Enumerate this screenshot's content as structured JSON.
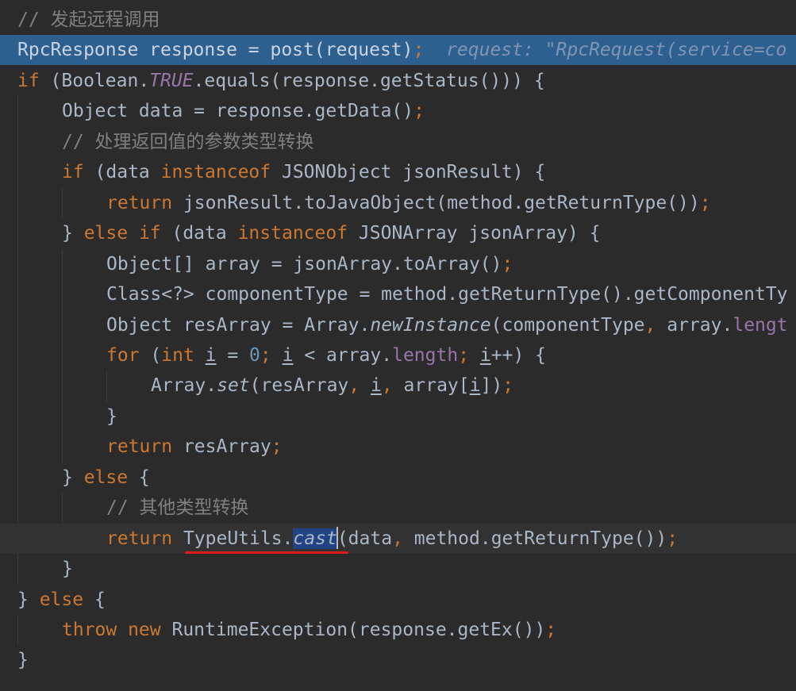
{
  "lines": [
    {
      "t": [
        [
          "cmt",
          "// 发起远程调用"
        ]
      ]
    },
    {
      "t": [
        [
          "",
          "RpcResponse response = post(request)"
        ],
        [
          "kw",
          ";"
        ],
        [
          "",
          "  "
        ],
        [
          "hint",
          "request: \"RpcRequest(service=co"
        ]
      ]
    },
    {
      "t": [
        [
          "kw",
          "if "
        ],
        [
          "",
          "(Boolean."
        ],
        [
          "sfield",
          "TRUE"
        ],
        [
          "",
          ".equals(response.getStatus())) {"
        ]
      ]
    },
    {
      "t": [
        [
          "",
          "Object data = response.getData()"
        ],
        [
          "kw",
          ";"
        ]
      ]
    },
    {
      "t": [
        [
          "cmt",
          "// 处理返回值的参数类型转换"
        ]
      ]
    },
    {
      "t": [
        [
          "kw",
          "if "
        ],
        [
          "",
          "(data "
        ],
        [
          "kw",
          "instanceof "
        ],
        [
          "",
          "JSONObject jsonResult) {"
        ]
      ]
    },
    {
      "t": [
        [
          "kw",
          "return "
        ],
        [
          "",
          "jsonResult.toJavaObject(method.getReturnType())"
        ],
        [
          "kw",
          ";"
        ]
      ]
    },
    {
      "t": [
        [
          "",
          "} "
        ],
        [
          "kw",
          "else if "
        ],
        [
          "",
          "(data "
        ],
        [
          "kw",
          "instanceof "
        ],
        [
          "",
          "JSONArray jsonArray) {"
        ]
      ]
    },
    {
      "t": [
        [
          "",
          "Object[] array = jsonArray.toArray()"
        ],
        [
          "kw",
          ";"
        ]
      ]
    },
    {
      "t": [
        [
          "",
          "Class<?> componentType = method.getReturnType().getComponentTy"
        ]
      ]
    },
    {
      "t": [
        [
          "",
          "Object resArray = Array."
        ],
        [
          "smeth",
          "newInstance"
        ],
        [
          "",
          "(componentType"
        ],
        [
          "kw",
          ", "
        ],
        [
          "",
          "array."
        ],
        [
          "field",
          "lengt"
        ]
      ]
    },
    {
      "t": [
        [
          "kw",
          "for "
        ],
        [
          "",
          "("
        ],
        [
          "kw",
          "int "
        ],
        [
          "ul",
          "i"
        ],
        [
          "",
          " = "
        ],
        [
          "num",
          "0"
        ],
        [
          "kw",
          "; "
        ],
        [
          "ul",
          "i"
        ],
        [
          "",
          " < array."
        ],
        [
          "field",
          "length"
        ],
        [
          "kw",
          "; "
        ],
        [
          "ul",
          "i"
        ],
        [
          "",
          "++) {"
        ]
      ]
    },
    {
      "t": [
        [
          "",
          "Array."
        ],
        [
          "smeth",
          "set"
        ],
        [
          "",
          "(resArray"
        ],
        [
          "kw",
          ", "
        ],
        [
          "ul",
          "i"
        ],
        [
          "kw",
          ", "
        ],
        [
          "",
          "array["
        ],
        [
          "ul",
          "i"
        ],
        [
          "",
          "])"
        ],
        [
          "kw",
          ";"
        ]
      ]
    },
    {
      "t": [
        [
          "",
          "}"
        ]
      ]
    },
    {
      "t": [
        [
          "kw",
          "return "
        ],
        [
          "",
          "resArray"
        ],
        [
          "kw",
          ";"
        ]
      ]
    },
    {
      "t": [
        [
          "",
          "} "
        ],
        [
          "kw",
          "else "
        ],
        [
          "",
          "{"
        ]
      ]
    },
    {
      "t": [
        [
          "cmt",
          "// 其他类型转换"
        ]
      ]
    },
    {
      "t": [
        [
          "kw",
          "return "
        ],
        [
          "",
          "TypeUtils."
        ],
        [
          "selcast",
          "cast"
        ],
        [
          "caret",
          ""
        ],
        [
          "",
          "(data"
        ],
        [
          "kw",
          ", "
        ],
        [
          "",
          "method.getReturnType())"
        ],
        [
          "kw",
          ";"
        ]
      ]
    },
    {
      "t": [
        [
          "",
          "}"
        ]
      ]
    },
    {
      "t": [
        [
          "",
          "} "
        ],
        [
          "kw",
          "else "
        ],
        [
          "",
          "{"
        ]
      ]
    },
    {
      "t": [
        [
          "kw",
          "throw new "
        ],
        [
          "",
          "RuntimeException(response.getEx())"
        ],
        [
          "kw",
          ";"
        ]
      ]
    },
    {
      "t": [
        [
          "",
          "}"
        ]
      ]
    }
  ]
}
